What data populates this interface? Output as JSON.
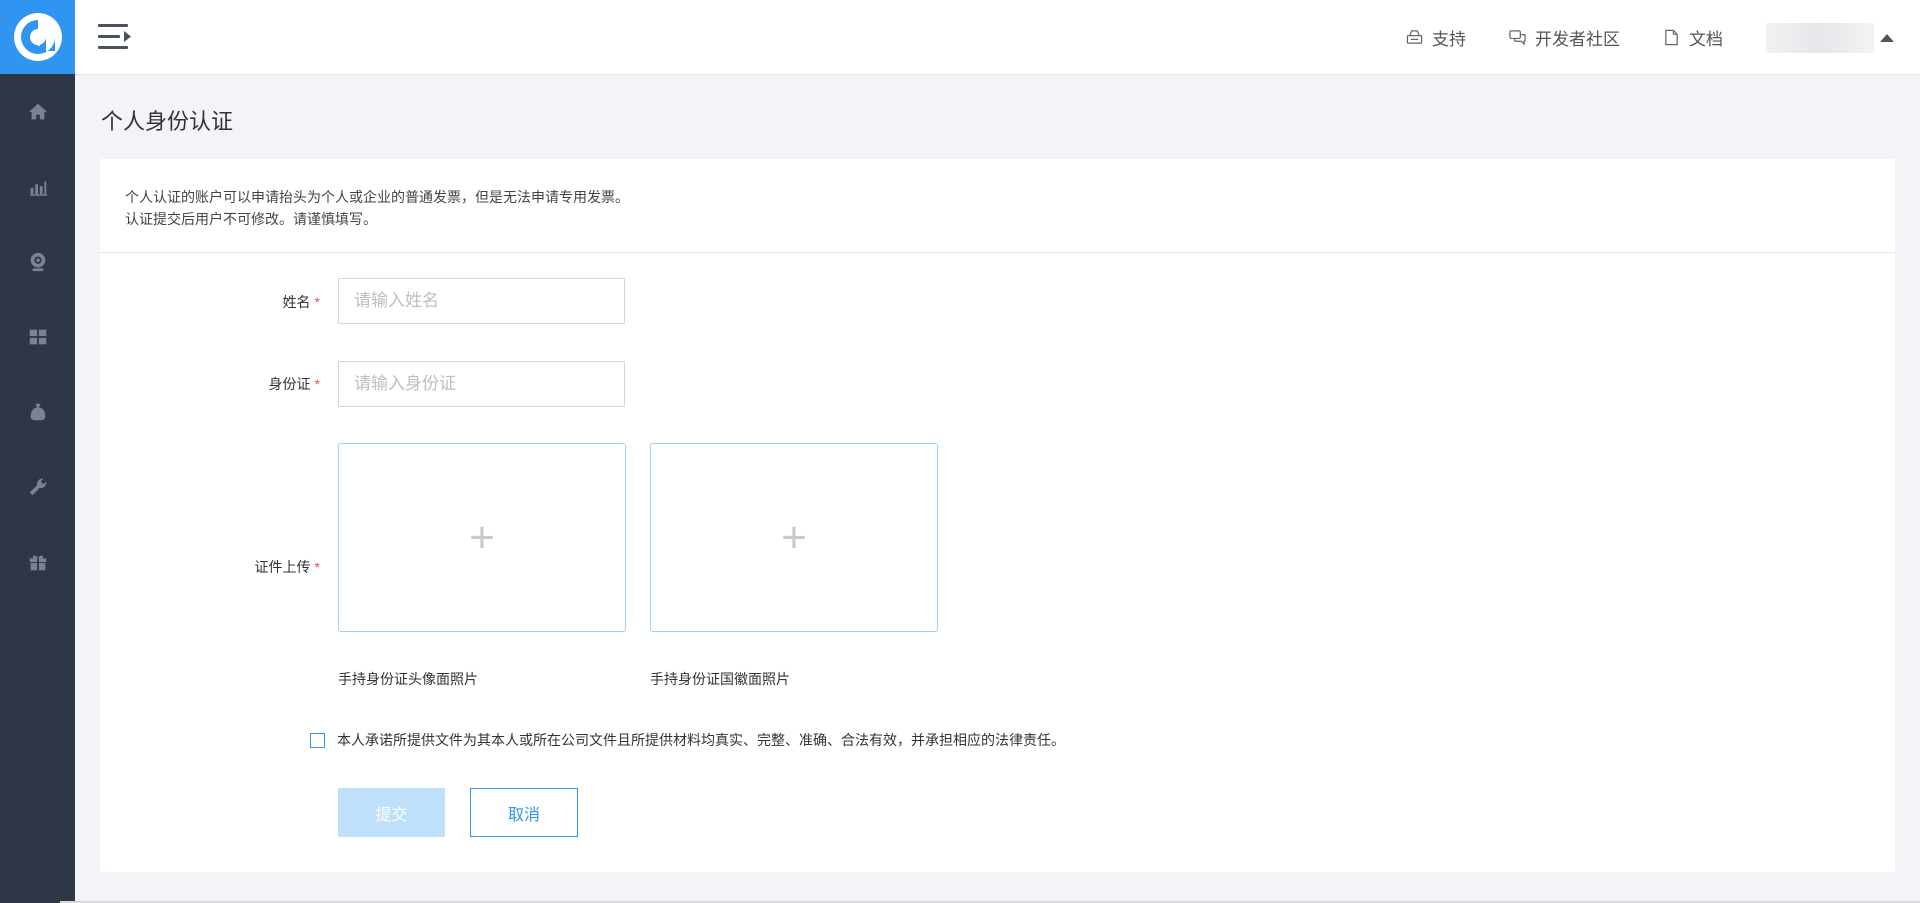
{
  "header": {
    "support_label": "支持",
    "community_label": "开发者社区",
    "docs_label": "文档"
  },
  "page": {
    "title": "个人身份认证"
  },
  "notice": {
    "line1": "个人认证的账户可以申请抬头为个人或企业的普通发票，但是无法申请专用发票。",
    "line2": "认证提交后用户不可修改。请谨慎填写。"
  },
  "form": {
    "name_label": "姓名",
    "name_placeholder": "请输入姓名",
    "id_label": "身份证",
    "id_placeholder": "请输入身份证",
    "upload_label": "证件上传",
    "required_mark": "*",
    "upload_plus": "+",
    "upload_front_caption": "手持身份证头像面照片",
    "upload_back_caption": "手持身份证国徽面照片",
    "agreement": "本人承诺所提供文件为其本人或所在公司文件且所提供材料均真实、完整、准确、合法有效，并承担相应的法律责任。",
    "submit_label": "提交",
    "cancel_label": "取消"
  },
  "colors": {
    "accent": "#2f95f0",
    "sidebar": "#2f3747",
    "required": "#f24a4a",
    "submit_disabled": "#bfe0fb"
  },
  "icons": {
    "sidebar": [
      "home-icon",
      "bar-chart-icon",
      "webcam-icon",
      "grid-icon",
      "money-bag-icon",
      "wrench-icon",
      "gift-icon"
    ],
    "header": [
      "hamburger-menu-icon",
      "printer-icon",
      "chat-icon",
      "document-icon"
    ]
  }
}
